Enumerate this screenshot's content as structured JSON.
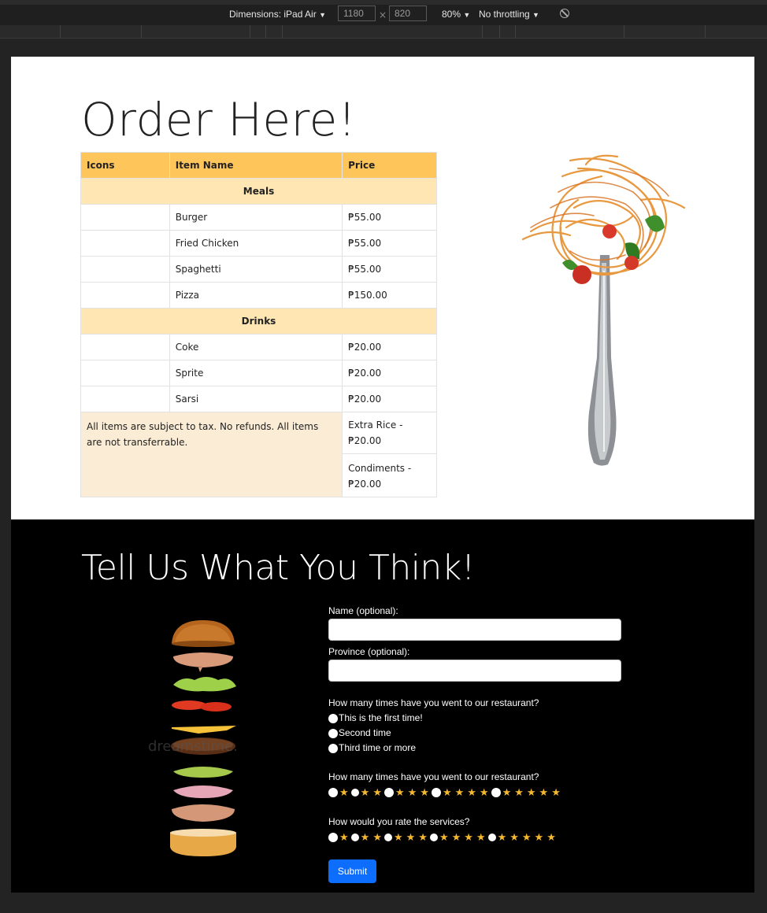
{
  "devtools": {
    "dimensions_label": "Dimensions: iPad Air",
    "width_value": "1180",
    "times": "×",
    "height_value": "820",
    "zoom": "80%",
    "throttling": "No throttling",
    "dropdown_glyph": "▼"
  },
  "order": {
    "title": "Order Here!",
    "headers": [
      "Icons",
      "Item Name",
      "Price"
    ],
    "categories": [
      {
        "name": "Meals",
        "items": [
          {
            "name": "Burger",
            "price": "₱55.00"
          },
          {
            "name": "Fried Chicken",
            "price": "₱55.00"
          },
          {
            "name": "Spaghetti",
            "price": "₱55.00"
          },
          {
            "name": "Pizza",
            "price": "₱150.00"
          }
        ]
      },
      {
        "name": "Drinks",
        "items": [
          {
            "name": "Coke",
            "price": "₱20.00"
          },
          {
            "name": "Sprite",
            "price": "₱20.00"
          },
          {
            "name": "Sarsi",
            "price": "₱20.00"
          }
        ]
      }
    ],
    "note": "All items are subject to tax. No refunds. All items are not transferrable.",
    "extras": [
      "Extra Rice - ₱20.00",
      "Condiments - ₱20.00"
    ]
  },
  "feedback": {
    "title": "Tell Us What You Think!",
    "name_label": "Name (optional):",
    "province_label": "Province (optional):",
    "visits_question": "How many times have you went to our restaurant?",
    "visit_options": [
      "This is the first time!",
      "Second time",
      "Third time or more"
    ],
    "rating_question_1": "How many times have you went to our restaurant?",
    "rating_question_2": "How would you rate the services?",
    "star_glyph": "★",
    "submit_label": "Submit",
    "watermark": "dreamstime."
  },
  "colors": {
    "table_header": "#fec55b",
    "category_row": "#ffe6b3",
    "note_row": "#fbecd5",
    "star": "#f5b82e",
    "submit": "#0d6efd"
  }
}
